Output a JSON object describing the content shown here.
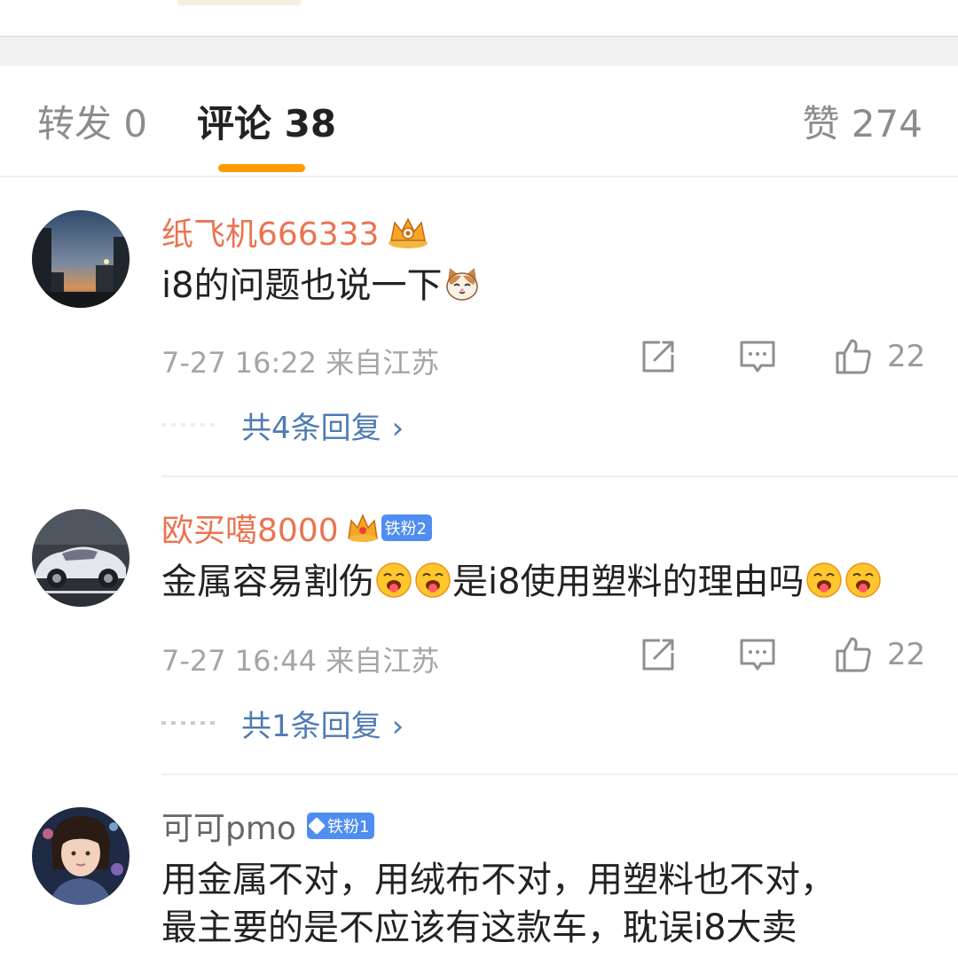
{
  "tabs": {
    "repost": "转发 0",
    "comments": "评论 38",
    "likes": "赞 274"
  },
  "comments": [
    {
      "username": "纸飞机666333",
      "badge": "crown",
      "text": "i8的问题也说一下",
      "emoji": "cat-face",
      "time": "7-27 16:22",
      "location": "来自江苏",
      "likes": "22",
      "replies": "共4条回复"
    },
    {
      "username": "欧买噶8000",
      "badge": "crown",
      "fan_badge": "铁粉2",
      "text_parts": [
        "金属容易割伤",
        "是i8使用塑料的理由吗"
      ],
      "emoji": "tongue-face",
      "time": "7-27 16:44",
      "location": "来自江苏",
      "likes": "22",
      "replies": "共1条回复"
    },
    {
      "username": "可可pmo",
      "fan_badge": "铁粉1",
      "text_line1": "用金属不对，用绒布不对，用塑料也不对，",
      "text_line2": "最主要的是不应该有这款车，耽误i8大卖"
    }
  ],
  "colors": {
    "accent": "#ff9a02",
    "username": "#eb7350",
    "reply_link": "#4f7bb3",
    "fan_badge": "#4f8ef0"
  },
  "icons": [
    "share-icon",
    "comment-icon",
    "like-icon",
    "chevron-right-icon",
    "crown-icon",
    "diamond-icon"
  ]
}
